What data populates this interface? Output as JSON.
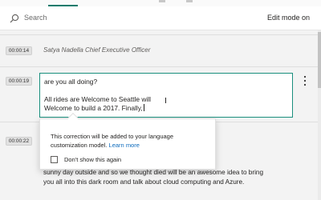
{
  "search": {
    "label": "Search",
    "icon": "search-icon"
  },
  "toolbar": {
    "edit_mode_label": "Edit mode on"
  },
  "transcript": {
    "segments": [
      {
        "timestamp": "00:00:14",
        "speaker": "Satya Nadella Chief Executive Officer"
      },
      {
        "timestamp": "00:00:19",
        "lines": [
          "are you all doing?",
          "",
          "All rides are Welcome to Seattle will",
          "Welcome to build a 2017. Finally,"
        ]
      },
      {
        "timestamp": "00:00:22",
        "lines": [
          "sunny day outside and so we thought died will be an awesome idea to bring",
          "you all into this dark room and talk about cloud computing and Azure."
        ]
      }
    ]
  },
  "correction_popup": {
    "message": "This correction will be added to your language customization model.",
    "link_label": "Learn more",
    "checkbox_label": "Don't show this again",
    "checkbox_checked": false
  },
  "colors": {
    "accent": "#1a8f7d",
    "link": "#0f6cbd"
  }
}
